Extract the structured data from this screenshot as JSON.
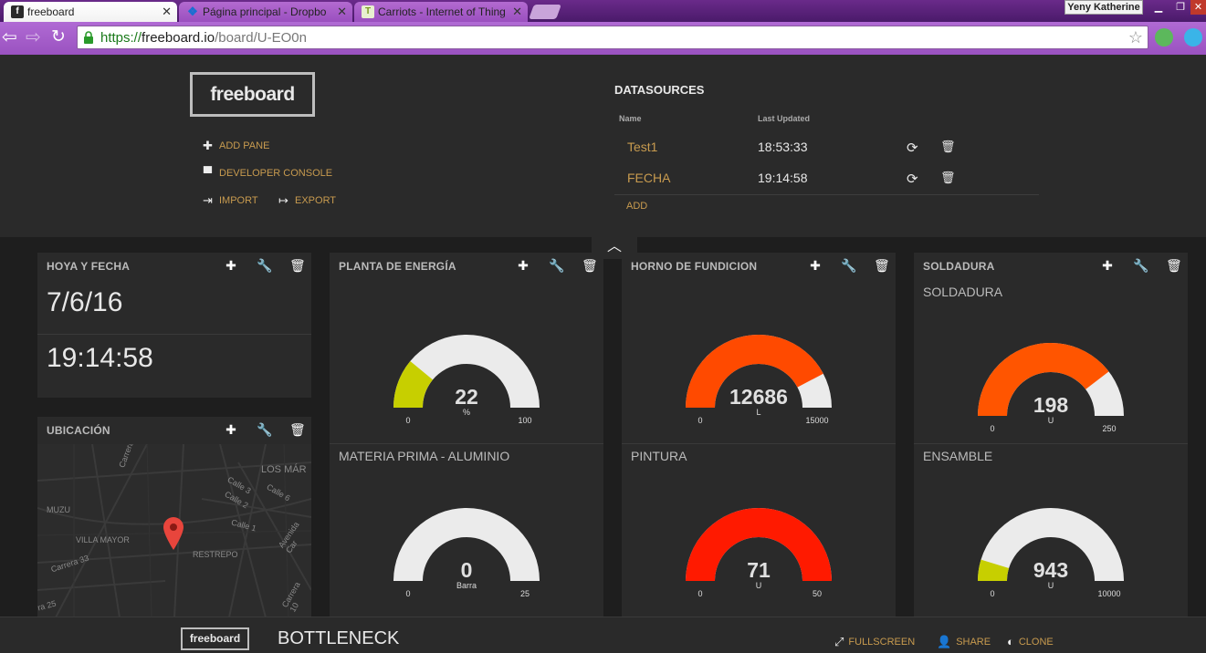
{
  "browser": {
    "tabs": [
      {
        "title": "freeboard",
        "favicon": "f",
        "active": true
      },
      {
        "title": "Página principal - Dropbo",
        "favicon": "dropbox-icon",
        "active": false
      },
      {
        "title": "Carriots - Internet of Thing",
        "favicon": "carriots-icon",
        "active": false
      }
    ],
    "user": "Yeny Katherine",
    "url_scheme": "https://",
    "url_host": "freeboard.io",
    "url_path": "/board/U-EO0n"
  },
  "admin": {
    "logo": "freeboard",
    "add_pane": "ADD PANE",
    "developer_console": "DEVELOPER CONSOLE",
    "import": "IMPORT",
    "export": "EXPORT",
    "datasources_title": "DATASOURCES",
    "col_name": "Name",
    "col_last_updated": "Last Updated",
    "datasources": [
      {
        "name": "Test1",
        "last_updated": "18:53:33"
      },
      {
        "name": "FECHA",
        "last_updated": "19:14:58"
      }
    ],
    "add": "ADD"
  },
  "panes": {
    "hoya": {
      "title": "HOYA Y FECHA",
      "date": "7/6/16",
      "time": "19:14:58"
    },
    "ubicacion": {
      "title": "UBICACIÓN",
      "map_labels": [
        "LOS MÁR",
        "MUZU",
        "VILLA MAYOR",
        "RESTREPO",
        "Carrera 33",
        "Calle 3",
        "Calle 2",
        "Calle 6",
        "Calle 1",
        "Avenida Car",
        "Carrera 10",
        "Carrera",
        "ra 25"
      ]
    },
    "planta": {
      "title": "PLANTA DE ENERGÍA",
      "gauge1": {
        "title": "",
        "value": "22",
        "units": "%",
        "min": "0",
        "max": "100",
        "level": 0.22,
        "color": "#c7cf00"
      },
      "gauge2": {
        "title": "MATERIA PRIMA - ALUMINIO",
        "value": "0",
        "units": "Barra",
        "min": "0",
        "max": "25",
        "level": 0,
        "color": "#c7cf00"
      }
    },
    "horno": {
      "title": "HORNO DE FUNDICION",
      "gauge1": {
        "title": "",
        "value": "12686",
        "units": "L",
        "min": "0",
        "max": "15000",
        "level": 0.8457,
        "color": "#ff4a00"
      },
      "gauge2": {
        "title": "PINTURA",
        "value": "71",
        "units": "U",
        "min": "0",
        "max": "50",
        "level": 1,
        "color": "#ff1a00"
      }
    },
    "soldadura": {
      "title": "SOLDADURA",
      "gauge1": {
        "title": "SOLDADURA",
        "value": "198",
        "units": "U",
        "min": "0",
        "max": "250",
        "level": 0.792,
        "color": "#ff5500"
      },
      "gauge2": {
        "title": "ENSAMBLE",
        "value": "943",
        "units": "U",
        "min": "0",
        "max": "10000",
        "level": 0.0943,
        "color": "#c7cf00"
      }
    }
  },
  "footer": {
    "logo": "freeboard",
    "board_title": "BOTTLENECK",
    "fullscreen": "FULLSCREEN",
    "share": "SHARE",
    "clone": "CLONE"
  },
  "colors": {
    "accent": "#c89b4f",
    "pane_bg": "#2a2a2a",
    "board_bg": "#1e1e1e",
    "gauge_track": "#ebebeb"
  }
}
